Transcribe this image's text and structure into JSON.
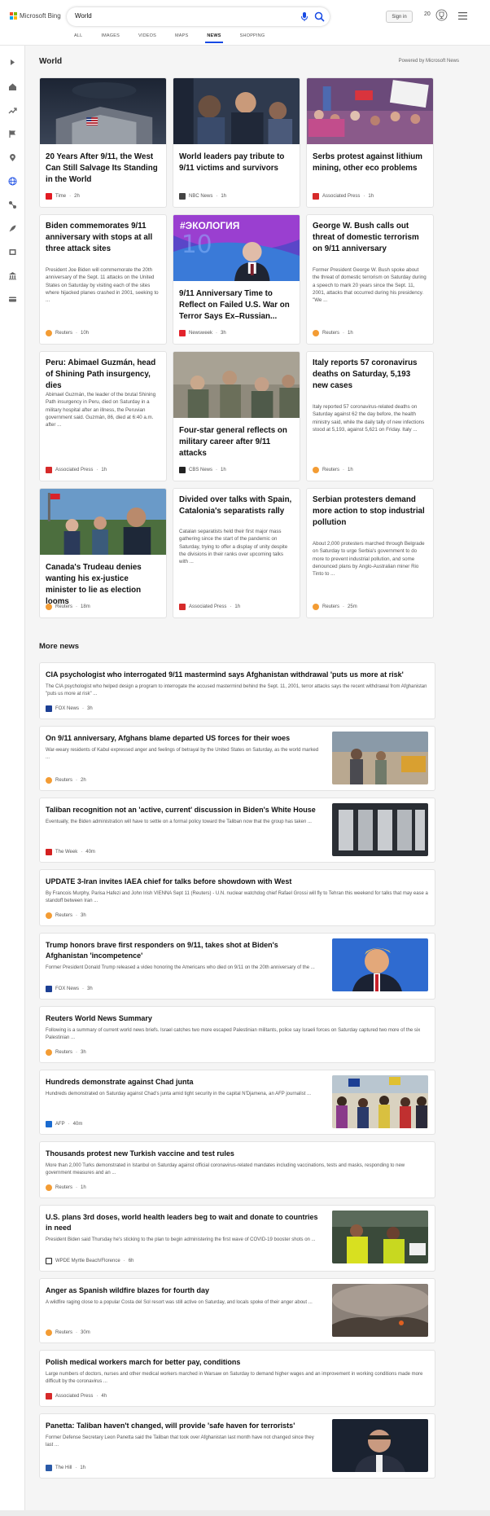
{
  "header": {
    "logo_text": "Microsoft Bing",
    "search_value": "World",
    "signin_label": "Sign in",
    "rewards_count": "20",
    "tabs": [
      "ALL",
      "IMAGES",
      "VIDEOS",
      "MAPS",
      "NEWS",
      "SHOPPING"
    ],
    "active_tab": "NEWS"
  },
  "colors": {
    "accent": "#174ae4",
    "bing_blue": "#0078d4",
    "background": "#f5f5f5"
  },
  "section": {
    "title": "World",
    "powered_by": "Powered by Microsoft News"
  },
  "cards": [
    {
      "title": "20 Years After 9/11, the West Can Still Salvage Its Standing in the World",
      "source": "Time",
      "age": "2h",
      "logo_color": "#e21b23",
      "image": "pentagon-flag"
    },
    {
      "title": "World leaders pay tribute to 9/11 victims and survivors",
      "source": "NBC News",
      "age": "1h",
      "logo_color": "#444444",
      "image": "mourners"
    },
    {
      "title": "Serbs protest against lithium mining, other eco problems",
      "source": "Associated Press",
      "age": "1h",
      "logo_color": "#d62a2a",
      "image": "protest-crowd"
    },
    {
      "title": "Biden commemorates 9/11 anniversary with stops at all three attack sites",
      "desc": "President Joe Biden will commemorate the 20th anniversary of the Sept. 11 attacks on the United States on Saturday by visiting each of the sites where hijacked planes crashed in 2001, seeking to ...",
      "source": "Reuters",
      "age": "10h",
      "logo_color": "#f39c34"
    },
    {
      "title": "9/11 Anniversary Time to Reflect on Failed U.S. War on Terror Says Ex–Russian...",
      "source": "Newsweek",
      "age": "3h",
      "logo_color": "#e3232c",
      "image": "medvedev",
      "image_caption": "#ЭКОЛОГИЯ"
    },
    {
      "title": "George W. Bush calls out threat of domestic terrorism on 9/11 anniversary",
      "desc": "Former President George W. Bush spoke about the threat of domestic terrorism on Saturday during a speech to mark 20 years since the Sept. 11, 2001, attacks that occurred during his presidency. \"We ...",
      "source": "Reuters",
      "age": "1h",
      "logo_color": "#f39c34"
    },
    {
      "title": "Peru: Abimael Guzmán, head of Shining Path insurgency, dies",
      "desc": "Abimael Guzmán, the leader of the brutal Shining Path insurgency in Peru, died on Saturday in a military hospital after an illness, the Peruvian government said. Guzmán, 86, died at 6:40 a.m. after ...",
      "source": "Associated Press",
      "age": "1h",
      "logo_color": "#d62a2a"
    },
    {
      "title": "Four-star general reflects on military career after 9/11 attacks",
      "source": "CBS News",
      "age": "1h",
      "logo_color": "#222222",
      "image": "soldiers"
    },
    {
      "title": "Italy reports 57 coronavirus deaths on Saturday, 5,193 new cases",
      "desc": "Italy reported 57 coronavirus-related deaths on Saturday against 62 the day before, the health ministry said, while the daily tally of new infections stood at 5,193, against 5,621 on Friday. Italy ...",
      "source": "Reuters",
      "age": "1h",
      "logo_color": "#f39c34"
    },
    {
      "title": "Canada's Trudeau denies wanting his ex-justice minister to lie as election looms",
      "source": "Reuters",
      "age": "18m",
      "logo_color": "#f39c34",
      "image": "trudeau"
    },
    {
      "title": "Divided over talks with Spain, Catalonia's separatists rally",
      "desc": "Catalan separatists held their first major mass gathering since the start of the pandemic on Saturday, trying to offer a display of unity despite the divisions in their ranks over upcoming talks with ...",
      "source": "Associated Press",
      "age": "1h",
      "logo_color": "#d62a2a"
    },
    {
      "title": "Serbian protesters demand more action to stop industrial pollution",
      "desc": "About 2,000 protesters marched through Belgrade on Saturday to urge Serbia's government to do more to prevent industrial pollution, and some denounced plans by Anglo-Australian miner Rio Tinto to ...",
      "source": "Reuters",
      "age": "25m",
      "logo_color": "#f39c34"
    }
  ],
  "more_news": {
    "title": "More news",
    "items": [
      {
        "title": "CIA psychologist who interrogated 9/11 mastermind says Afghanistan withdrawal 'puts us more at risk'",
        "desc": "The CIA psychologist who helped design a program to interrogate the accused mastermind behind the Sept. 11, 2001, terror attacks says the recent withdrawal from Afghanistan \"puts us more at risk\" ...",
        "source": "FOX News",
        "age": "3h",
        "logo_color": "#1c3f94"
      },
      {
        "title": "On 9/11 anniversary, Afghans blame departed US forces for their woes",
        "desc": "War-weary residents of Kabul expressed anger and feelings of betrayal by the United States on Saturday, as the world marked ...",
        "source": "Reuters",
        "age": "2h",
        "logo_color": "#f39c34",
        "image": "kabul-street"
      },
      {
        "title": "Taliban recognition not an 'active, current' discussion in Biden's White House",
        "desc": "Eventually, the Biden administration will have to settle on a formal policy toward the Taliban now that the group has taken ...",
        "source": "The Week",
        "age": "40m",
        "logo_color": "#d42020",
        "image": "flags-building"
      },
      {
        "title": "UPDATE 3-Iran invites IAEA chief for talks before showdown with West",
        "desc": "By Francois Murphy, Parisa Hafezi and John Irish VIENNA Sept 11 (Reuters) - U.N. nuclear watchdog chief Rafael Grossi will fly to Tehran this weekend for talks that may ease a standoff between Iran ...",
        "source": "Reuters",
        "age": "3h",
        "logo_color": "#f39c34"
      },
      {
        "title": "Trump honors brave first responders on 9/11, takes shot at Biden's Afghanistan 'incompetence'",
        "desc": "Former President Donald Trump released a video honoring the Americans who died on 9/11 on the 20th anniversary of the ...",
        "source": "FOX News",
        "age": "3h",
        "logo_color": "#1c3f94",
        "image": "trump"
      },
      {
        "title": "Reuters World News Summary",
        "desc": "Following is a summary of current world news briefs. Israel catches two more escaped Palestinian militants, police say Israeli forces on Saturday captured two more of the six Palestinian ...",
        "source": "Reuters",
        "age": "3h",
        "logo_color": "#f39c34"
      },
      {
        "title": "Hundreds demonstrate against Chad junta",
        "desc": "Hundreds demonstrated on Saturday against Chad's junta amid tight security in the capital N'Djamena, an AFP journalist ...",
        "source": "AFP",
        "age": "40m",
        "logo_color": "#1a6bd0",
        "image": "chad-crowd"
      },
      {
        "title": "Thousands protest new Turkish vaccine and test rules",
        "desc": "More than 2,000 Turks demonstrated in Istanbul on Saturday against official coronavirus-related mandates including vaccinations, tests and masks, responding to new government measures and an ...",
        "source": "Reuters",
        "age": "1h",
        "logo_color": "#f39c34"
      },
      {
        "title": "U.S. plans 3rd doses, world health leaders beg to wait and donate to countries in need",
        "desc": "President Biden said Thursday he's sticking to the plan to begin administering the first wave of COVID-19 booster shots on ...",
        "source": "WPDE Myrtle Beach/Florence",
        "age": "6h",
        "logo_color": "#222222",
        "image": "vaccine-workers"
      },
      {
        "title": "Anger as Spanish wildfire blazes for fourth day",
        "desc": "A wildfire raging close to a popular Costa del Sol resort was still active on Saturday, and locals spoke of their anger about ...",
        "source": "Reuters",
        "age": "30m",
        "logo_color": "#f39c34",
        "image": "wildfire"
      },
      {
        "title": "Polish medical workers march for better pay, conditions",
        "desc": "Large numbers of doctors, nurses and other medical workers marched in Warsaw on Saturday to demand higher wages and an improvement in working conditions made more difficult by the coronavirus ...",
        "source": "Associated Press",
        "age": "4h",
        "logo_color": "#d62a2a"
      },
      {
        "title": "Panetta: Taliban haven't changed, will provide 'safe haven for terrorists'",
        "desc": "Former Defense Secretary Leon Panetta said the Taliban that took over Afghanistan last month have not changed since they last ...",
        "source": "The Hill",
        "age": "1h",
        "logo_color": "#2a5aa8",
        "image": "panetta"
      }
    ]
  }
}
